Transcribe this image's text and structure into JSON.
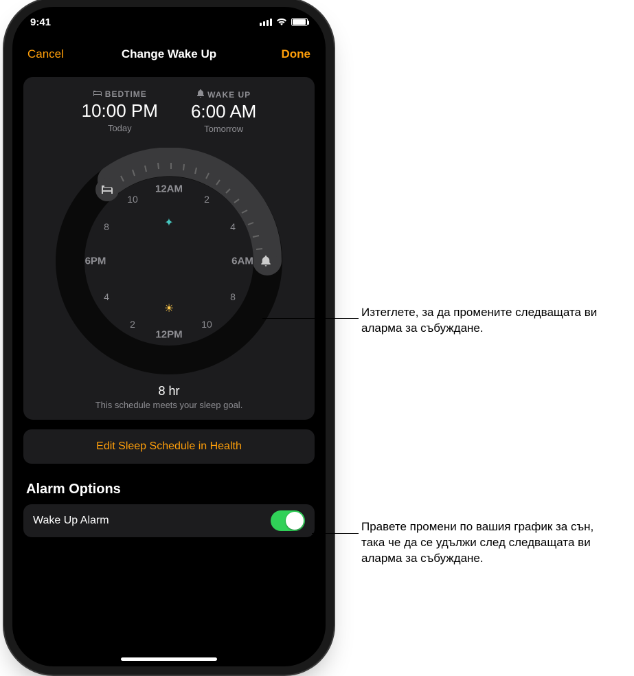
{
  "status": {
    "time": "9:41"
  },
  "nav": {
    "cancel": "Cancel",
    "title": "Change Wake Up",
    "done": "Done"
  },
  "schedule": {
    "bedtime_label": "BEDTIME",
    "bedtime_value": "10:00 PM",
    "bedtime_day": "Today",
    "wake_label": "WAKE UP",
    "wake_value": "6:00 AM",
    "wake_day": "Tomorrow",
    "duration": "8 hr",
    "goal_text": "This schedule meets your sleep goal."
  },
  "clock": {
    "h12am": "12AM",
    "h2": "2",
    "h4": "4",
    "h6am": "6AM",
    "h8": "8",
    "h10": "10",
    "h12pm": "12PM",
    "h14": "2",
    "h16": "4",
    "h6pm": "6PM",
    "h20": "8",
    "h22": "10"
  },
  "edit_row": "Edit Sleep Schedule in Health",
  "options": {
    "header": "Alarm Options",
    "wake_alarm_label": "Wake Up Alarm",
    "wake_alarm_on": true
  },
  "callouts": {
    "c1": "Изтеглете, за да промените следващата ви аларма за събуждане.",
    "c2": "Правете промени по вашия график за сън, така че да се удължи след следващата ви аларма за събуждане."
  }
}
